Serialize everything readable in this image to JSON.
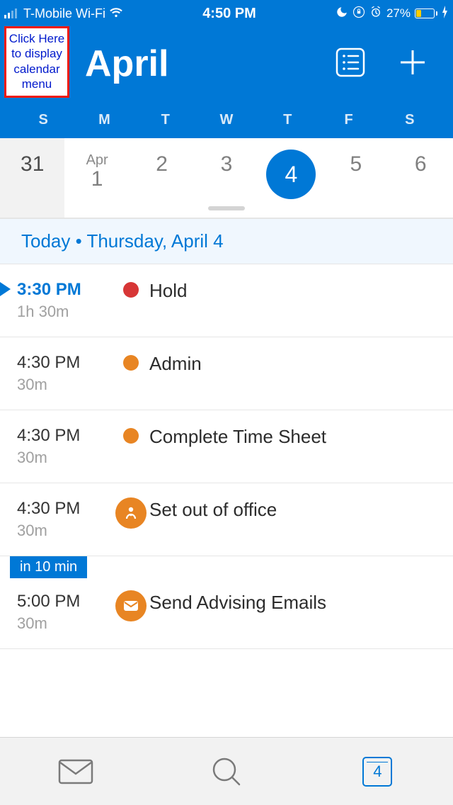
{
  "status": {
    "carrier": "T-Mobile Wi-Fi",
    "time": "4:50 PM",
    "battery_pct": "27%"
  },
  "callout": {
    "text": "Click Here to display calendar menu"
  },
  "header": {
    "month": "April"
  },
  "weekdays": [
    "S",
    "M",
    "T",
    "W",
    "T",
    "F",
    "S"
  ],
  "dates": {
    "prev": "31",
    "d1_month": "Apr",
    "d1": "1",
    "d2": "2",
    "d3": "3",
    "d4": "4",
    "d5": "5",
    "d6": "6"
  },
  "today_label": "Today • Thursday, April 4",
  "events": [
    {
      "start": "3:30 PM",
      "dur": "1h 30m",
      "title": "Hold",
      "color": "red",
      "icon": "dot",
      "current": true,
      "badge": ""
    },
    {
      "start": "4:30 PM",
      "dur": "30m",
      "title": "Admin",
      "color": "orange",
      "icon": "dot",
      "current": false,
      "badge": ""
    },
    {
      "start": "4:30 PM",
      "dur": "30m",
      "title": "Complete Time Sheet",
      "color": "orange",
      "icon": "dot",
      "current": false,
      "badge": ""
    },
    {
      "start": "4:30 PM",
      "dur": "30m",
      "title": "Set out of office",
      "color": "orange",
      "icon": "person",
      "current": false,
      "badge": ""
    },
    {
      "start": "5:00 PM",
      "dur": "30m",
      "title": "Send Advising Emails",
      "color": "orange",
      "icon": "mail",
      "current": false,
      "badge": "in 10 min"
    }
  ],
  "tabbar": {
    "cal_day": "4"
  }
}
